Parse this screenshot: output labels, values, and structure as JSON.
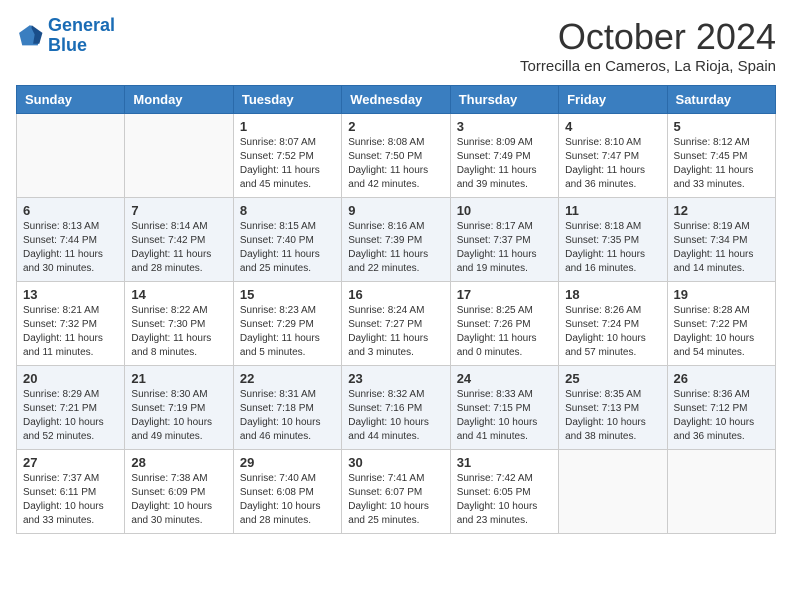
{
  "header": {
    "logo_line1": "General",
    "logo_line2": "Blue",
    "month": "October 2024",
    "location": "Torrecilla en Cameros, La Rioja, Spain"
  },
  "weekdays": [
    "Sunday",
    "Monday",
    "Tuesday",
    "Wednesday",
    "Thursday",
    "Friday",
    "Saturday"
  ],
  "weeks": [
    [
      {
        "day": "",
        "info": ""
      },
      {
        "day": "",
        "info": ""
      },
      {
        "day": "1",
        "info": "Sunrise: 8:07 AM\nSunset: 7:52 PM\nDaylight: 11 hours and 45 minutes."
      },
      {
        "day": "2",
        "info": "Sunrise: 8:08 AM\nSunset: 7:50 PM\nDaylight: 11 hours and 42 minutes."
      },
      {
        "day": "3",
        "info": "Sunrise: 8:09 AM\nSunset: 7:49 PM\nDaylight: 11 hours and 39 minutes."
      },
      {
        "day": "4",
        "info": "Sunrise: 8:10 AM\nSunset: 7:47 PM\nDaylight: 11 hours and 36 minutes."
      },
      {
        "day": "5",
        "info": "Sunrise: 8:12 AM\nSunset: 7:45 PM\nDaylight: 11 hours and 33 minutes."
      }
    ],
    [
      {
        "day": "6",
        "info": "Sunrise: 8:13 AM\nSunset: 7:44 PM\nDaylight: 11 hours and 30 minutes."
      },
      {
        "day": "7",
        "info": "Sunrise: 8:14 AM\nSunset: 7:42 PM\nDaylight: 11 hours and 28 minutes."
      },
      {
        "day": "8",
        "info": "Sunrise: 8:15 AM\nSunset: 7:40 PM\nDaylight: 11 hours and 25 minutes."
      },
      {
        "day": "9",
        "info": "Sunrise: 8:16 AM\nSunset: 7:39 PM\nDaylight: 11 hours and 22 minutes."
      },
      {
        "day": "10",
        "info": "Sunrise: 8:17 AM\nSunset: 7:37 PM\nDaylight: 11 hours and 19 minutes."
      },
      {
        "day": "11",
        "info": "Sunrise: 8:18 AM\nSunset: 7:35 PM\nDaylight: 11 hours and 16 minutes."
      },
      {
        "day": "12",
        "info": "Sunrise: 8:19 AM\nSunset: 7:34 PM\nDaylight: 11 hours and 14 minutes."
      }
    ],
    [
      {
        "day": "13",
        "info": "Sunrise: 8:21 AM\nSunset: 7:32 PM\nDaylight: 11 hours and 11 minutes."
      },
      {
        "day": "14",
        "info": "Sunrise: 8:22 AM\nSunset: 7:30 PM\nDaylight: 11 hours and 8 minutes."
      },
      {
        "day": "15",
        "info": "Sunrise: 8:23 AM\nSunset: 7:29 PM\nDaylight: 11 hours and 5 minutes."
      },
      {
        "day": "16",
        "info": "Sunrise: 8:24 AM\nSunset: 7:27 PM\nDaylight: 11 hours and 3 minutes."
      },
      {
        "day": "17",
        "info": "Sunrise: 8:25 AM\nSunset: 7:26 PM\nDaylight: 11 hours and 0 minutes."
      },
      {
        "day": "18",
        "info": "Sunrise: 8:26 AM\nSunset: 7:24 PM\nDaylight: 10 hours and 57 minutes."
      },
      {
        "day": "19",
        "info": "Sunrise: 8:28 AM\nSunset: 7:22 PM\nDaylight: 10 hours and 54 minutes."
      }
    ],
    [
      {
        "day": "20",
        "info": "Sunrise: 8:29 AM\nSunset: 7:21 PM\nDaylight: 10 hours and 52 minutes."
      },
      {
        "day": "21",
        "info": "Sunrise: 8:30 AM\nSunset: 7:19 PM\nDaylight: 10 hours and 49 minutes."
      },
      {
        "day": "22",
        "info": "Sunrise: 8:31 AM\nSunset: 7:18 PM\nDaylight: 10 hours and 46 minutes."
      },
      {
        "day": "23",
        "info": "Sunrise: 8:32 AM\nSunset: 7:16 PM\nDaylight: 10 hours and 44 minutes."
      },
      {
        "day": "24",
        "info": "Sunrise: 8:33 AM\nSunset: 7:15 PM\nDaylight: 10 hours and 41 minutes."
      },
      {
        "day": "25",
        "info": "Sunrise: 8:35 AM\nSunset: 7:13 PM\nDaylight: 10 hours and 38 minutes."
      },
      {
        "day": "26",
        "info": "Sunrise: 8:36 AM\nSunset: 7:12 PM\nDaylight: 10 hours and 36 minutes."
      }
    ],
    [
      {
        "day": "27",
        "info": "Sunrise: 7:37 AM\nSunset: 6:11 PM\nDaylight: 10 hours and 33 minutes."
      },
      {
        "day": "28",
        "info": "Sunrise: 7:38 AM\nSunset: 6:09 PM\nDaylight: 10 hours and 30 minutes."
      },
      {
        "day": "29",
        "info": "Sunrise: 7:40 AM\nSunset: 6:08 PM\nDaylight: 10 hours and 28 minutes."
      },
      {
        "day": "30",
        "info": "Sunrise: 7:41 AM\nSunset: 6:07 PM\nDaylight: 10 hours and 25 minutes."
      },
      {
        "day": "31",
        "info": "Sunrise: 7:42 AM\nSunset: 6:05 PM\nDaylight: 10 hours and 23 minutes."
      },
      {
        "day": "",
        "info": ""
      },
      {
        "day": "",
        "info": ""
      }
    ]
  ]
}
